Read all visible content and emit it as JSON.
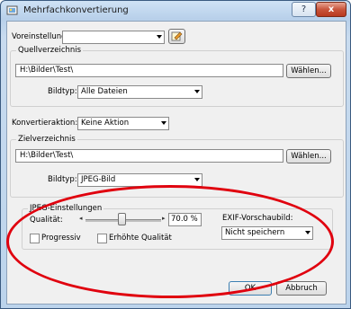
{
  "window": {
    "title": "Mehrfachkonvertierung"
  },
  "titlebar": {
    "help": "?",
    "close": "x"
  },
  "preset": {
    "label": "Voreinstellung:",
    "value": ""
  },
  "source": {
    "group_title": "Quellverzeichnis",
    "path": "H:\\Bilder\\Test\\",
    "browse_label": "Wählen...",
    "filetype_label": "Bildtyp:",
    "filetype_value": "Alle Dateien"
  },
  "convert_action": {
    "label": "Konvertieraktion:",
    "value": "Keine Aktion"
  },
  "target": {
    "group_title": "Zielverzeichnis",
    "path": "H:\\Bilder\\Test\\",
    "browse_label": "Wählen...",
    "filetype_label": "Bildtyp:",
    "filetype_value": "JPEG-Bild"
  },
  "jpeg": {
    "group_title": "JPEG-Einstellungen",
    "quality_label": "Qualität:",
    "quality_value": "70.0 %",
    "quality_level": 0.7,
    "progressive_label": "Progressiv",
    "progressive_checked": false,
    "high_quality_label": "Erhöhte Qualität",
    "high_quality_checked": false,
    "exif_label": "EXIF-Vorschaubild:",
    "exif_value": "Nicht speichern"
  },
  "buttons": {
    "ok": "OK",
    "cancel": "Abbruch"
  },
  "icons": {
    "app": "app-icon",
    "edit": "edit-icon"
  },
  "colors": {
    "annotation": "#e0000e"
  }
}
